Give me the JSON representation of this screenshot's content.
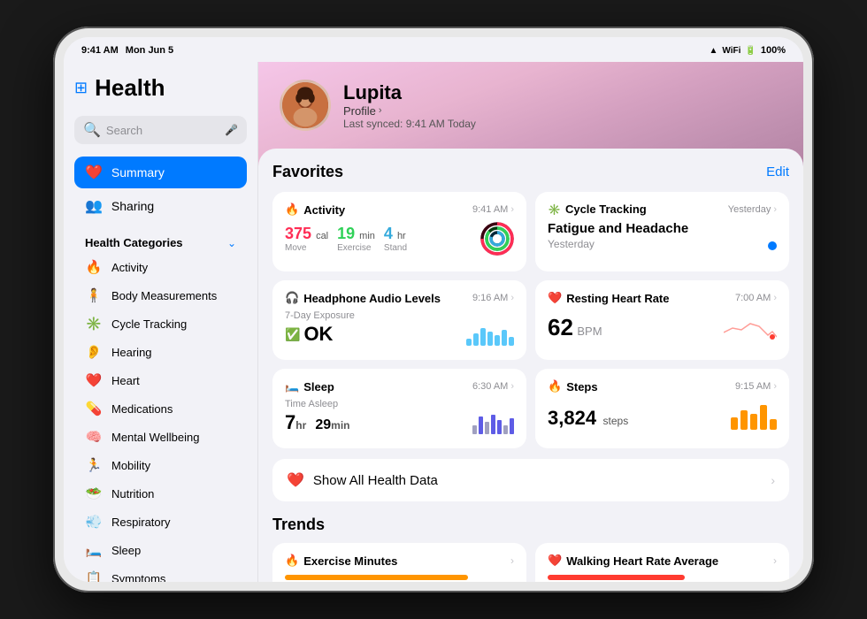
{
  "device": {
    "status_bar": {
      "time": "9:41 AM",
      "day": "Mon Jun 5",
      "wifi": "WiFi",
      "battery": "100%"
    }
  },
  "sidebar": {
    "app_title": "Health",
    "search": {
      "placeholder": "Search",
      "mic": true
    },
    "nav": [
      {
        "id": "summary",
        "label": "Summary",
        "icon": "❤️",
        "active": true
      },
      {
        "id": "sharing",
        "label": "Sharing",
        "icon": "👥",
        "active": false
      }
    ],
    "categories_title": "Health Categories",
    "categories": [
      {
        "id": "activity",
        "label": "Activity",
        "icon": "🔥"
      },
      {
        "id": "body-measurements",
        "label": "Body Measurements",
        "icon": "🧍"
      },
      {
        "id": "cycle-tracking",
        "label": "Cycle Tracking",
        "icon": "⭕"
      },
      {
        "id": "hearing",
        "label": "Hearing",
        "icon": "👂"
      },
      {
        "id": "heart",
        "label": "Heart",
        "icon": "❤️"
      },
      {
        "id": "medications",
        "label": "Medications",
        "icon": "💊"
      },
      {
        "id": "mental-wellbeing",
        "label": "Mental Wellbeing",
        "icon": "🧠"
      },
      {
        "id": "mobility",
        "label": "Mobility",
        "icon": "🏃"
      },
      {
        "id": "nutrition",
        "label": "Nutrition",
        "icon": "🥗"
      },
      {
        "id": "respiratory",
        "label": "Respiratory",
        "icon": "💨"
      },
      {
        "id": "sleep",
        "label": "Sleep",
        "icon": "🛏️"
      },
      {
        "id": "symptoms",
        "label": "Symptoms",
        "icon": "📋"
      }
    ]
  },
  "profile": {
    "name": "Lupita",
    "link": "Profile",
    "sync": "Last synced: 9:41 AM Today",
    "avatar_emoji": "😊"
  },
  "main": {
    "favorites": {
      "title": "Favorites",
      "edit_label": "Edit",
      "cards": [
        {
          "id": "activity",
          "title": "Activity",
          "icon": "🔥",
          "icon_color": "#ff2d55",
          "time": "9:41 AM",
          "move": "375",
          "move_unit": "cal",
          "exercise": "19",
          "exercise_unit": "min",
          "stand": "4",
          "stand_unit": "hr"
        },
        {
          "id": "cycle-tracking",
          "title": "Cycle Tracking",
          "icon": "✳️",
          "icon_color": "#007aff",
          "time": "Yesterday",
          "symptom": "Fatigue and Headache",
          "symptom_date": "Yesterday"
        },
        {
          "id": "headphone-audio",
          "title": "Headphone Audio Levels",
          "icon": "🎧",
          "icon_color": "#5ac8fa",
          "time": "9:16 AM",
          "exposure_label": "7-Day Exposure",
          "status": "OK"
        },
        {
          "id": "resting-heart-rate",
          "title": "Resting Heart Rate",
          "icon": "❤️",
          "icon_color": "#ff3b30",
          "time": "7:00 AM",
          "value": "62",
          "unit": "BPM"
        },
        {
          "id": "sleep",
          "title": "Sleep",
          "icon": "🛏️",
          "icon_color": "#5e5ce6",
          "time": "6:30 AM",
          "label": "Time Asleep",
          "hours": "7",
          "minutes": "29"
        },
        {
          "id": "steps",
          "title": "Steps",
          "icon": "🔥",
          "icon_color": "#ff9500",
          "time": "9:15 AM",
          "value": "3,824",
          "unit": "steps"
        }
      ]
    },
    "show_all": {
      "label": "Show All Health Data"
    },
    "trends": {
      "title": "Trends",
      "items": [
        {
          "id": "exercise-minutes",
          "title": "Exercise Minutes",
          "icon": "🔥",
          "icon_color": "#ff9500"
        },
        {
          "id": "walking-heart-rate",
          "title": "Walking Heart Rate Average",
          "icon": "❤️",
          "icon_color": "#ff3b30"
        }
      ]
    }
  }
}
